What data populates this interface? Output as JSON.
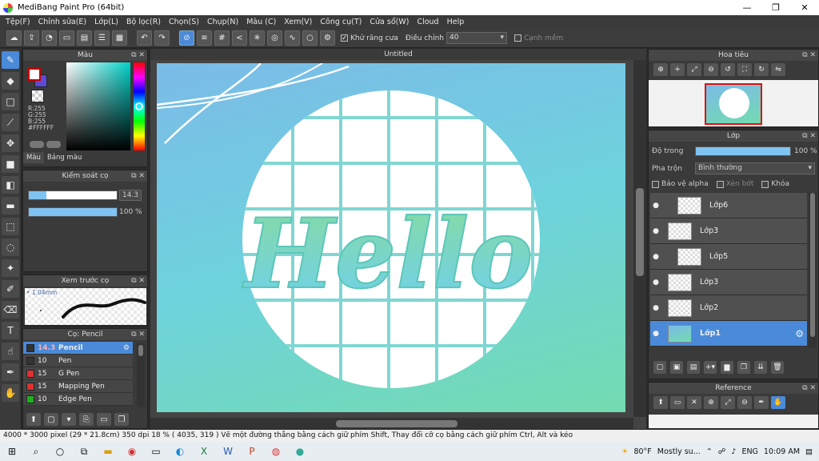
{
  "window": {
    "title": "MediBang Paint Pro (64bit)"
  },
  "menu": [
    "Tệp(F)",
    "Chỉnh sửa(E)",
    "Lớp(L)",
    "Bộ lọc(R)",
    "Chọn(S)",
    "Chụp(N)",
    "Màu (C)",
    "Xem(V)",
    "Công cụ(T)",
    "Cửa sổ(W)",
    "Cloud",
    "Help"
  ],
  "toolbar": {
    "antialias_label": "Khử răng cưa",
    "adjust_label": "Điều chỉnh",
    "adjust_value": "40",
    "edge_label": "Cạnh mềm"
  },
  "color_panel": {
    "title": "Màu",
    "rgb": [
      "R:255",
      "G:255",
      "B:255",
      "#FFFFFF"
    ],
    "tabs": [
      "Màu",
      "Bảng màu"
    ],
    "colors": {
      "foreground": "#ffffff",
      "background": "#5b4bd8"
    }
  },
  "brush_control": {
    "title": "Kiểm soát cọ",
    "size_value": "14.3",
    "opacity_value": "100 %",
    "size_fraction": 0.2,
    "opacity_fraction": 1.0
  },
  "brush_preview": {
    "title": "Xem trước cọ",
    "size": "1.04mm"
  },
  "brush_list": {
    "title": "Cọ: Pencil",
    "items": [
      {
        "size": "14.3",
        "name": "Pencil",
        "color": "#333333",
        "selected": true
      },
      {
        "size": "10",
        "name": "Pen",
        "color": "#333333",
        "selected": false
      },
      {
        "size": "15",
        "name": "G Pen",
        "color": "#e03030",
        "selected": false
      },
      {
        "size": "15",
        "name": "Mapping Pen",
        "color": "#e03030",
        "selected": false
      },
      {
        "size": "10",
        "name": "Edge Pen",
        "color": "#20b020",
        "selected": false
      }
    ]
  },
  "canvas": {
    "tab_title": "Untitled",
    "artwork_text": "Hello"
  },
  "navigator": {
    "title": "Hoa tiêu"
  },
  "layers_panel": {
    "title": "Lớp",
    "opacity_label": "Độ trong",
    "opacity_value": "100 %",
    "blend_label": "Pha trộn",
    "blend_value": "Bình thường",
    "protect_alpha": "Bảo vệ alpha",
    "clipping": "Xén bớt",
    "lock": "Khóa",
    "layers": [
      {
        "name": "Lớp6",
        "selected": false,
        "grouped": true
      },
      {
        "name": "Lớp3",
        "selected": false,
        "grouped": false
      },
      {
        "name": "Lớp5",
        "selected": false,
        "grouped": true
      },
      {
        "name": "Lớp3",
        "selected": false,
        "grouped": false
      },
      {
        "name": "Lớp2",
        "selected": false,
        "grouped": false
      },
      {
        "name": "Lớp1",
        "selected": true,
        "grouped": false
      }
    ]
  },
  "reference": {
    "title": "Reference"
  },
  "status": {
    "text": "4000 * 3000 pixel   (29 * 21.8cm)   350 dpi   18 %   ( 4035, 319 )   Vẽ một đường thẳng bằng cách giữ phím Shift, Thay đổi cỡ cọ bằng cách giữ phím Ctrl, Alt và kéo"
  },
  "taskbar": {
    "weather_temp": "80°F",
    "weather_desc": "Mostly su...",
    "lang": "ENG",
    "time": "10:09 AM"
  }
}
